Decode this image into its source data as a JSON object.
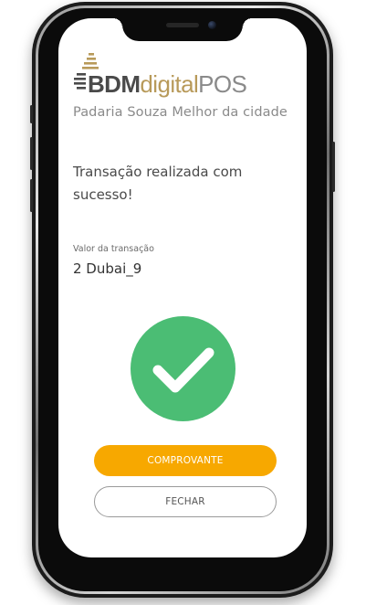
{
  "brand": {
    "bdm": "BDM",
    "digital": "digital",
    "pos": "POS",
    "colors": {
      "bdm": "#4a4a4a",
      "digital": "#b89a5a",
      "pos": "#8a8a8a"
    }
  },
  "store": {
    "name": "Padaria Souza Melhor da cidade"
  },
  "transaction": {
    "message": "Transação realizada com sucesso!",
    "value_label": "Valor da transação",
    "value": "2 Dubai_9"
  },
  "status": {
    "icon": "checkmark-icon",
    "color": "#4bbd74"
  },
  "buttons": {
    "receipt_label": "COMPROVANTE",
    "receipt_color": "#f7a800",
    "close_label": "FECHAR"
  }
}
